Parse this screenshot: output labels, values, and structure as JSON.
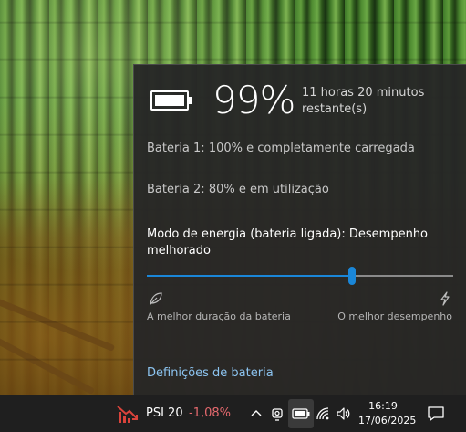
{
  "flyout": {
    "percent": "99%",
    "remaining": "11 horas 20 minutos restante(s)",
    "battery1": "Bateria 1: 100% e completamente carregada",
    "battery2": "Bateria 2: 80% e em utilização",
    "mode_title": "Modo de energia (bateria ligada): Desempenho melhorado",
    "slider_value_fraction": 0.67,
    "slider_left_label": "A melhor duração da bateria",
    "slider_right_label": "O melhor desempenho",
    "settings_link": "Definições de bateria"
  },
  "taskbar": {
    "stock_name": "PSI 20",
    "stock_change": "-1,08%",
    "clock_time": "16:19",
    "clock_date": "17/06/2025"
  },
  "colors": {
    "accent": "#1a86d8",
    "link": "#8cc4f0",
    "negative": "#e5696e",
    "stock_icon": "#d9433b"
  },
  "icons": {
    "battery": "battery-icon",
    "leaf": "leaf-icon",
    "bolt": "lightning-bolt-icon",
    "stock": "stock-down-icon",
    "chevron_up": "chevron-up-icon",
    "meet_now": "camera-icon",
    "tray_battery": "battery-tray-icon",
    "wifi": "wifi-icon",
    "volume": "speaker-icon",
    "notifications": "notification-icon"
  }
}
